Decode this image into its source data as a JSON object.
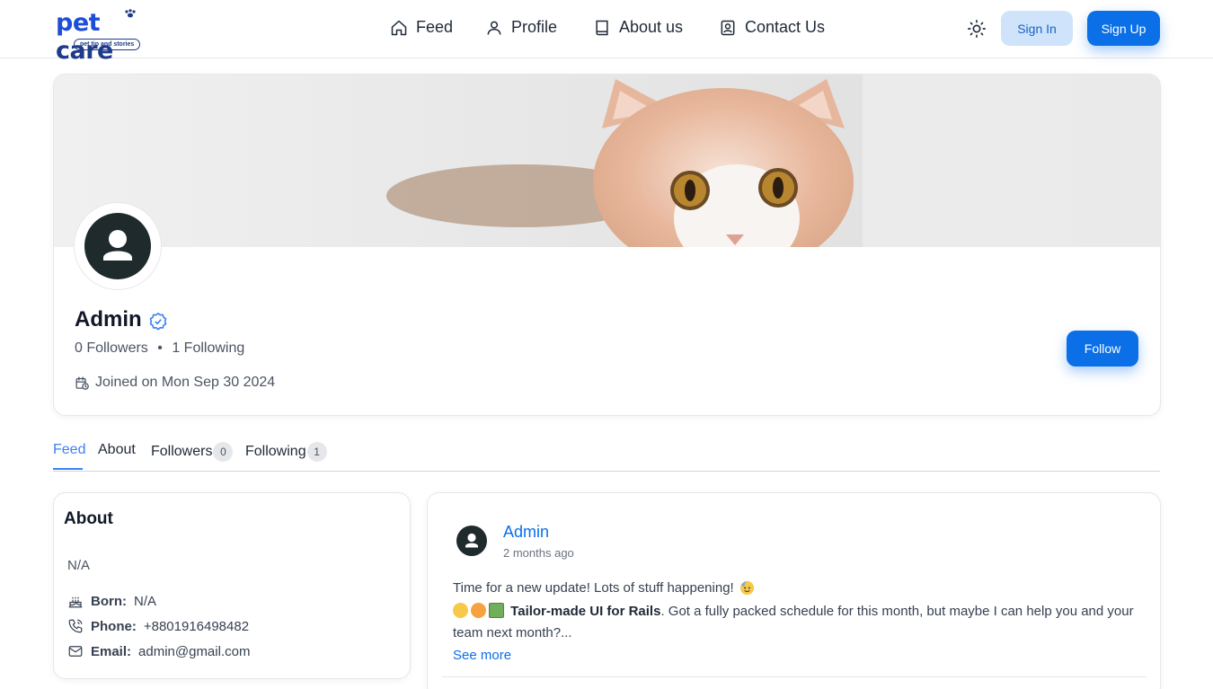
{
  "header": {
    "logo": {
      "word1": "pet",
      "word2": "care",
      "tagline": "pet tip and stories"
    },
    "nav": [
      {
        "label": "Feed",
        "icon": "home-icon"
      },
      {
        "label": "Profile",
        "icon": "user-icon"
      },
      {
        "label": "About us",
        "icon": "book-icon"
      },
      {
        "label": "Contact Us",
        "icon": "contact-icon"
      }
    ],
    "theme_icon": "sun-icon",
    "signin_label": "Sign In",
    "signup_label": "Sign Up"
  },
  "profile": {
    "name": "Admin",
    "followers_text": "0 Followers",
    "separator": "•",
    "following_text": "1 Following",
    "joined": "Joined on Mon Sep 30 2024",
    "follow_label": "Follow"
  },
  "tabs": [
    {
      "label": "Feed"
    },
    {
      "label": "About"
    },
    {
      "label": "Followers",
      "count": "0"
    },
    {
      "label": "Following",
      "count": "1"
    }
  ],
  "about": {
    "title": "About",
    "bio": "N/A",
    "born_label": "Born:",
    "born_value": "N/A",
    "phone_label": "Phone:",
    "phone_value": "+8801916498482",
    "email_label": "Email:",
    "email_value": "admin@gmail.com"
  },
  "post": {
    "author": "Admin",
    "time": "2 months ago",
    "line1": "Time for a new update! Lots of stuff happening!",
    "highlight": "Tailor-made UI for Rails",
    "line2_rest": ". Got a fully packed schedule for this month, but maybe I can help you and your team next month?...",
    "see_more": "See more"
  },
  "colors": {
    "primary": "#0b6fe8",
    "primary_light": "#cfe3fb",
    "tab_active": "#3b82f6"
  }
}
